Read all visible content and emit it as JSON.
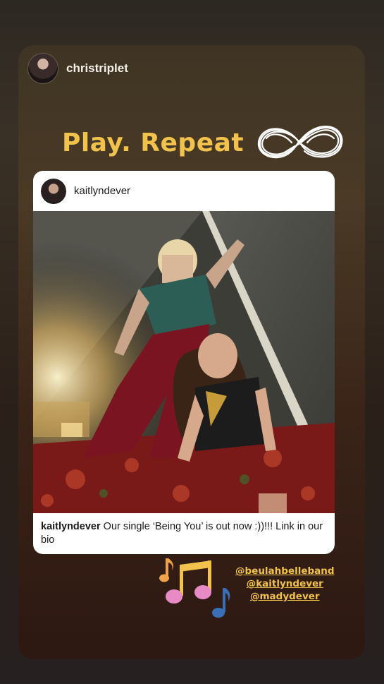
{
  "story": {
    "username": "christriplet",
    "headline": "Play. Repeat"
  },
  "post": {
    "username": "kaitlyndever",
    "caption_user": "kaitlyndever",
    "caption_text": " Our single ‘Being You’ is out now :))!!! Link in our bio"
  },
  "mentions": [
    "@beulahbelleband",
    "@kaitlyndever",
    "@madydever"
  ],
  "icons": {
    "infinity": "infinity-icon",
    "music": "music-notes-icon"
  },
  "colors": {
    "headline": "#f1c24c",
    "mention": "#f1c24c",
    "note_orange": "#f0a24a",
    "note_yellow": "#f1c24c",
    "note_pink": "#e88ac6",
    "note_blue": "#3b6fb5"
  }
}
